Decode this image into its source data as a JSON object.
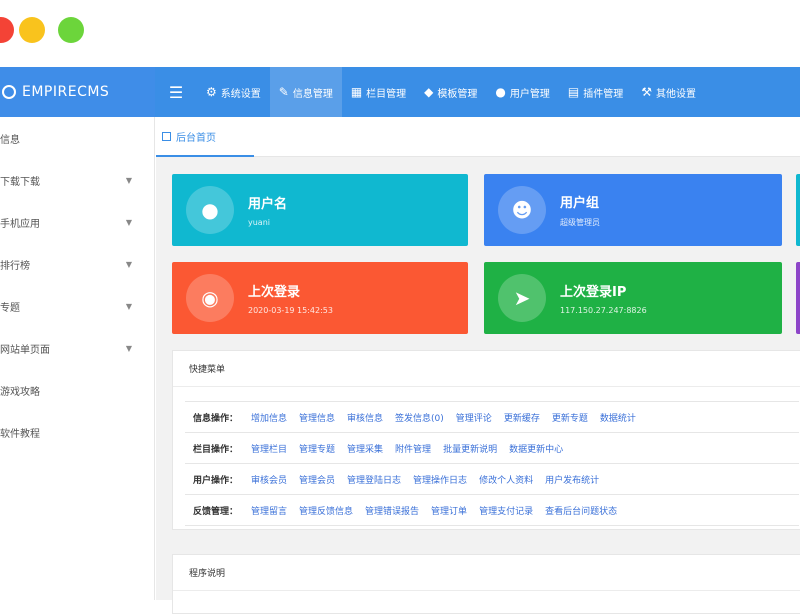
{
  "window": {
    "controls": [
      "close",
      "minimize",
      "maximize"
    ]
  },
  "brand": {
    "name": "EMPIRECMS",
    "icon": "globe-icon"
  },
  "topnav": [
    {
      "label": "系统设置",
      "icon": "gear-icon",
      "active": false
    },
    {
      "label": "信息管理",
      "icon": "edit-icon",
      "active": true
    },
    {
      "label": "栏目管理",
      "icon": "grid-icon",
      "active": false
    },
    {
      "label": "模板管理",
      "icon": "cube-icon",
      "active": false
    },
    {
      "label": "用户管理",
      "icon": "user-icon",
      "active": false
    },
    {
      "label": "插件管理",
      "icon": "document-icon",
      "active": false
    },
    {
      "label": "其他设置",
      "icon": "wrench-icon",
      "active": false
    }
  ],
  "sidebar": {
    "items": [
      {
        "label": "信息",
        "has_arrow": false
      },
      {
        "label": "下载下载",
        "has_arrow": true
      },
      {
        "label": "手机应用",
        "has_arrow": true
      },
      {
        "label": "排行榜",
        "has_arrow": true
      },
      {
        "label": "专题",
        "has_arrow": true
      },
      {
        "label": "网站单页面",
        "has_arrow": true
      },
      {
        "label": "游戏攻略",
        "has_arrow": false
      },
      {
        "label": "软件教程",
        "has_arrow": false
      }
    ]
  },
  "tabs": [
    {
      "label": "后台首页",
      "active": true
    }
  ],
  "cards": {
    "user": {
      "title": "用户名",
      "value": "yuani",
      "icon": "user-icon",
      "color": "#10b8d0"
    },
    "group": {
      "title": "用户组",
      "value": "超级管理员",
      "icon": "users-icon",
      "color": "#3a82f0"
    },
    "last_login": {
      "title": "上次登录",
      "value": "2020-03-19 15:42:53",
      "icon": "clock-icon",
      "color": "#fb5833"
    },
    "last_ip": {
      "title": "上次登录IP",
      "value": "117.150.27.247:8826",
      "icon": "location-arrow-icon",
      "color": "#1fb145"
    }
  },
  "quick_menu": {
    "title": "快捷菜单",
    "rows": [
      {
        "label": "信息操作：",
        "links": [
          "增加信息",
          "管理信息",
          "审核信息",
          "签发信息(0)",
          "管理评论",
          "更新缓存",
          "更新专题",
          "数据统计"
        ]
      },
      {
        "label": "栏目操作：",
        "links": [
          "管理栏目",
          "管理专题",
          "管理采集",
          "附件管理",
          "批量更新说明",
          "数据更新中心"
        ]
      },
      {
        "label": "用户操作：",
        "links": [
          "审核会员",
          "管理会员",
          "管理登陆日志",
          "管理操作日志",
          "修改个人资料",
          "用户发布统计"
        ]
      },
      {
        "label": "反馈管理：",
        "links": [
          "管理留言",
          "管理反馈信息",
          "管理错误报告",
          "管理订单",
          "管理支付记录",
          "查看后台问题状态"
        ]
      }
    ]
  },
  "program_panel": {
    "title": "程序说明"
  }
}
